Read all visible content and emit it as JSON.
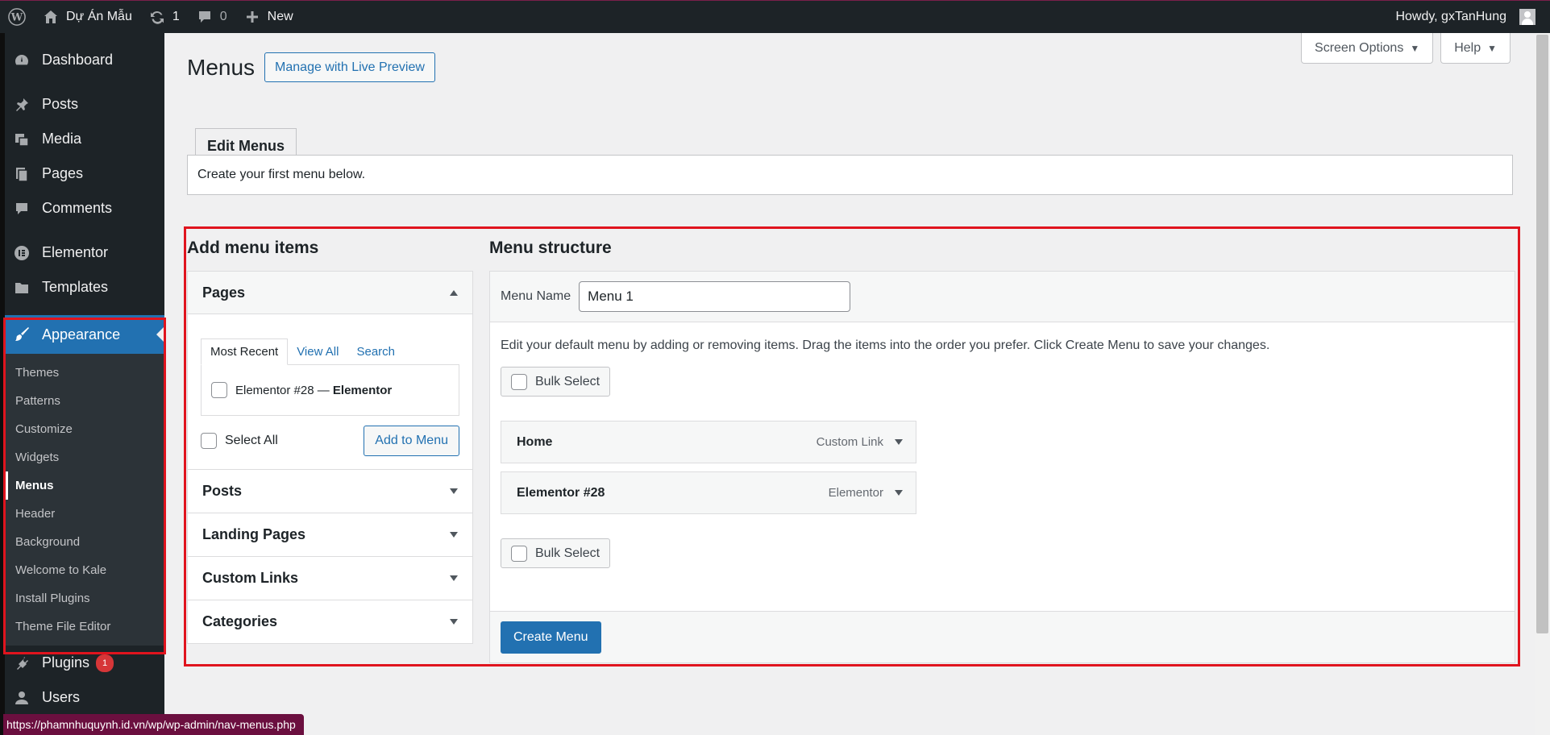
{
  "adminbar": {
    "site_name": "Dự Án Mẫu",
    "updates_count": "1",
    "comments_count": "0",
    "new_label": "New",
    "howdy": "Howdy, gxTanHung"
  },
  "sidebar": {
    "items": [
      {
        "label": "Dashboard",
        "icon": "dashboard-icon"
      },
      {
        "label": "Posts",
        "icon": "pin-icon"
      },
      {
        "label": "Media",
        "icon": "media-icon"
      },
      {
        "label": "Pages",
        "icon": "pages-icon"
      },
      {
        "label": "Comments",
        "icon": "comment-icon"
      },
      {
        "label": "Elementor",
        "icon": "elementor-icon"
      },
      {
        "label": "Templates",
        "icon": "folder-icon"
      },
      {
        "label": "Appearance",
        "icon": "paintbrush-icon"
      },
      {
        "label": "Plugins",
        "icon": "plugin-icon",
        "badge": "1"
      },
      {
        "label": "Users",
        "icon": "user-icon"
      }
    ],
    "appearance_sub": [
      "Themes",
      "Patterns",
      "Customize",
      "Widgets",
      "Menus",
      "Header",
      "Background",
      "Welcome to Kale",
      "Install Plugins",
      "Theme File Editor"
    ]
  },
  "header": {
    "title": "Menus",
    "live_preview": "Manage with Live Preview",
    "screen_options": "Screen Options",
    "help": "Help",
    "tab_edit": "Edit Menus",
    "notice": "Create your first menu below."
  },
  "add_items": {
    "title": "Add menu items",
    "pages": {
      "label": "Pages",
      "tabs": [
        "Most Recent",
        "View All",
        "Search"
      ],
      "item_name": "Elementor #28 — ",
      "item_type": "Elementor",
      "select_all": "Select All",
      "add_button": "Add to Menu"
    },
    "sections": [
      "Posts",
      "Landing Pages",
      "Custom Links",
      "Categories"
    ]
  },
  "structure": {
    "title": "Menu structure",
    "menu_name_label": "Menu Name",
    "menu_name_value": "Menu 1",
    "instructions": "Edit your default menu by adding or removing items. Drag the items into the order you prefer. Click Create Menu to save your changes.",
    "bulk_select": "Bulk Select",
    "items": [
      {
        "title": "Home",
        "type": "Custom Link"
      },
      {
        "title": "Elementor #28",
        "type": "Elementor"
      }
    ],
    "create_button": "Create Menu"
  },
  "status_url": "https://phamnhuquynh.id.vn/wp/wp-admin/nav-menus.php",
  "colors": {
    "accent": "#2271b1",
    "highlight_box": "#e0141e",
    "adminbar": "#1d2327"
  }
}
